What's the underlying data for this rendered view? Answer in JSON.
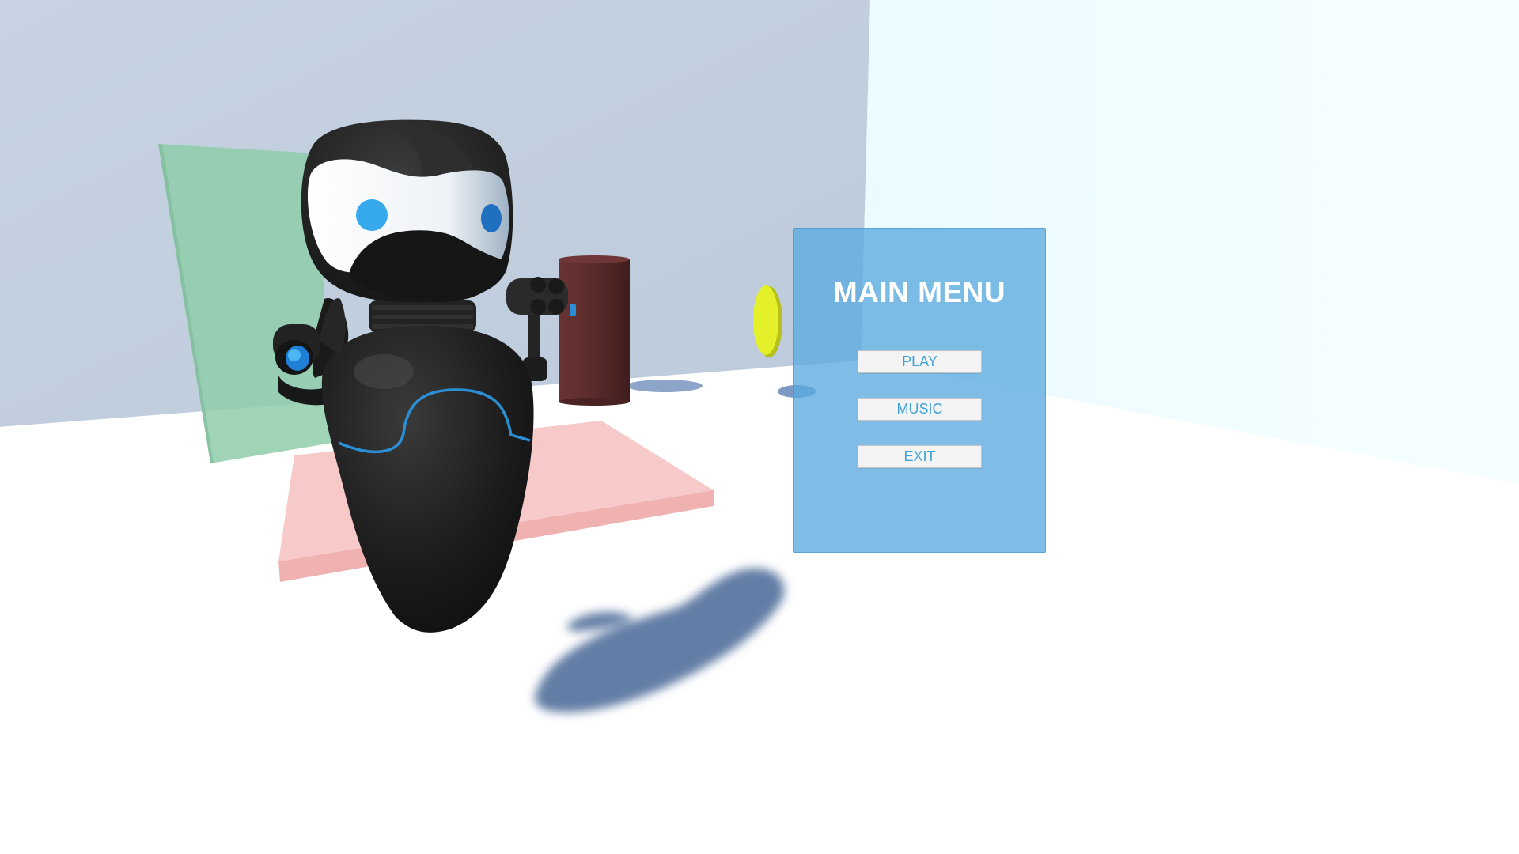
{
  "menu": {
    "title": "MAIN MENU",
    "buttons": {
      "play": "PLAY",
      "music": "MUSIC",
      "exit": "EXIT"
    }
  },
  "colors": {
    "panel": "#5babe0",
    "button_text": "#3fa3d8",
    "robot_body": "#1c1c1c",
    "robot_eyes": "#35a9ec",
    "accent_trim": "#2b8fd6",
    "coin": "#e4f12a",
    "pillar": "#5a2a2a",
    "green_panel": "#8fccaa",
    "pink_platform": "#f4b3b3",
    "shadow": "#647ea6",
    "back_wall": "#c3d0de"
  },
  "scene": {
    "objects": [
      "robot-character",
      "green-glass-panel",
      "pink-platform",
      "red-pillar",
      "yellow-coin",
      "robot-shadow"
    ]
  }
}
